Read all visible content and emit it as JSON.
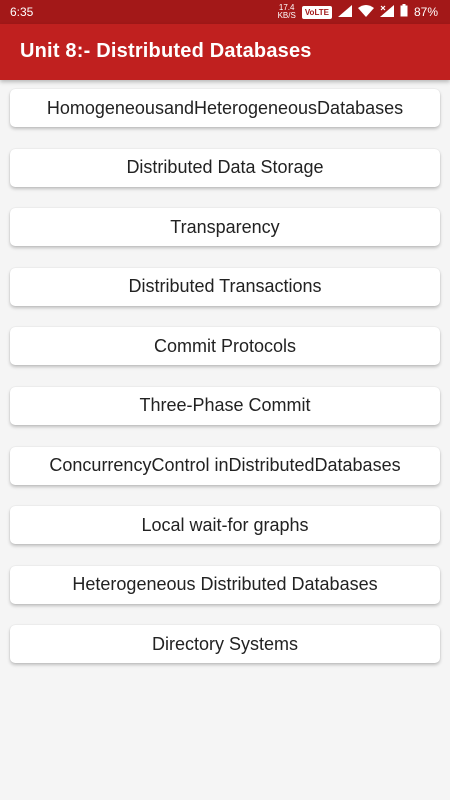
{
  "status_bar": {
    "time": "6:35",
    "speed_value": "17.4",
    "speed_unit": "KB/S",
    "volte": "VoLTE",
    "battery": "87%"
  },
  "app_bar": {
    "title": "Unit 8:- Distributed Databases"
  },
  "topics": [
    "HomogeneousandHeterogeneousDatabases",
    "Distributed Data Storage",
    "Transparency",
    "Distributed Transactions",
    "Commit Protocols",
    "Three-Phase Commit",
    "ConcurrencyControl inDistributedDatabases",
    "Local wait-for graphs",
    "Heterogeneous Distributed Databases",
    "Directory Systems"
  ],
  "colors": {
    "status_bar": "#a31818",
    "app_bar": "#c0201f",
    "background": "#f5f5f5",
    "card": "#ffffff"
  }
}
